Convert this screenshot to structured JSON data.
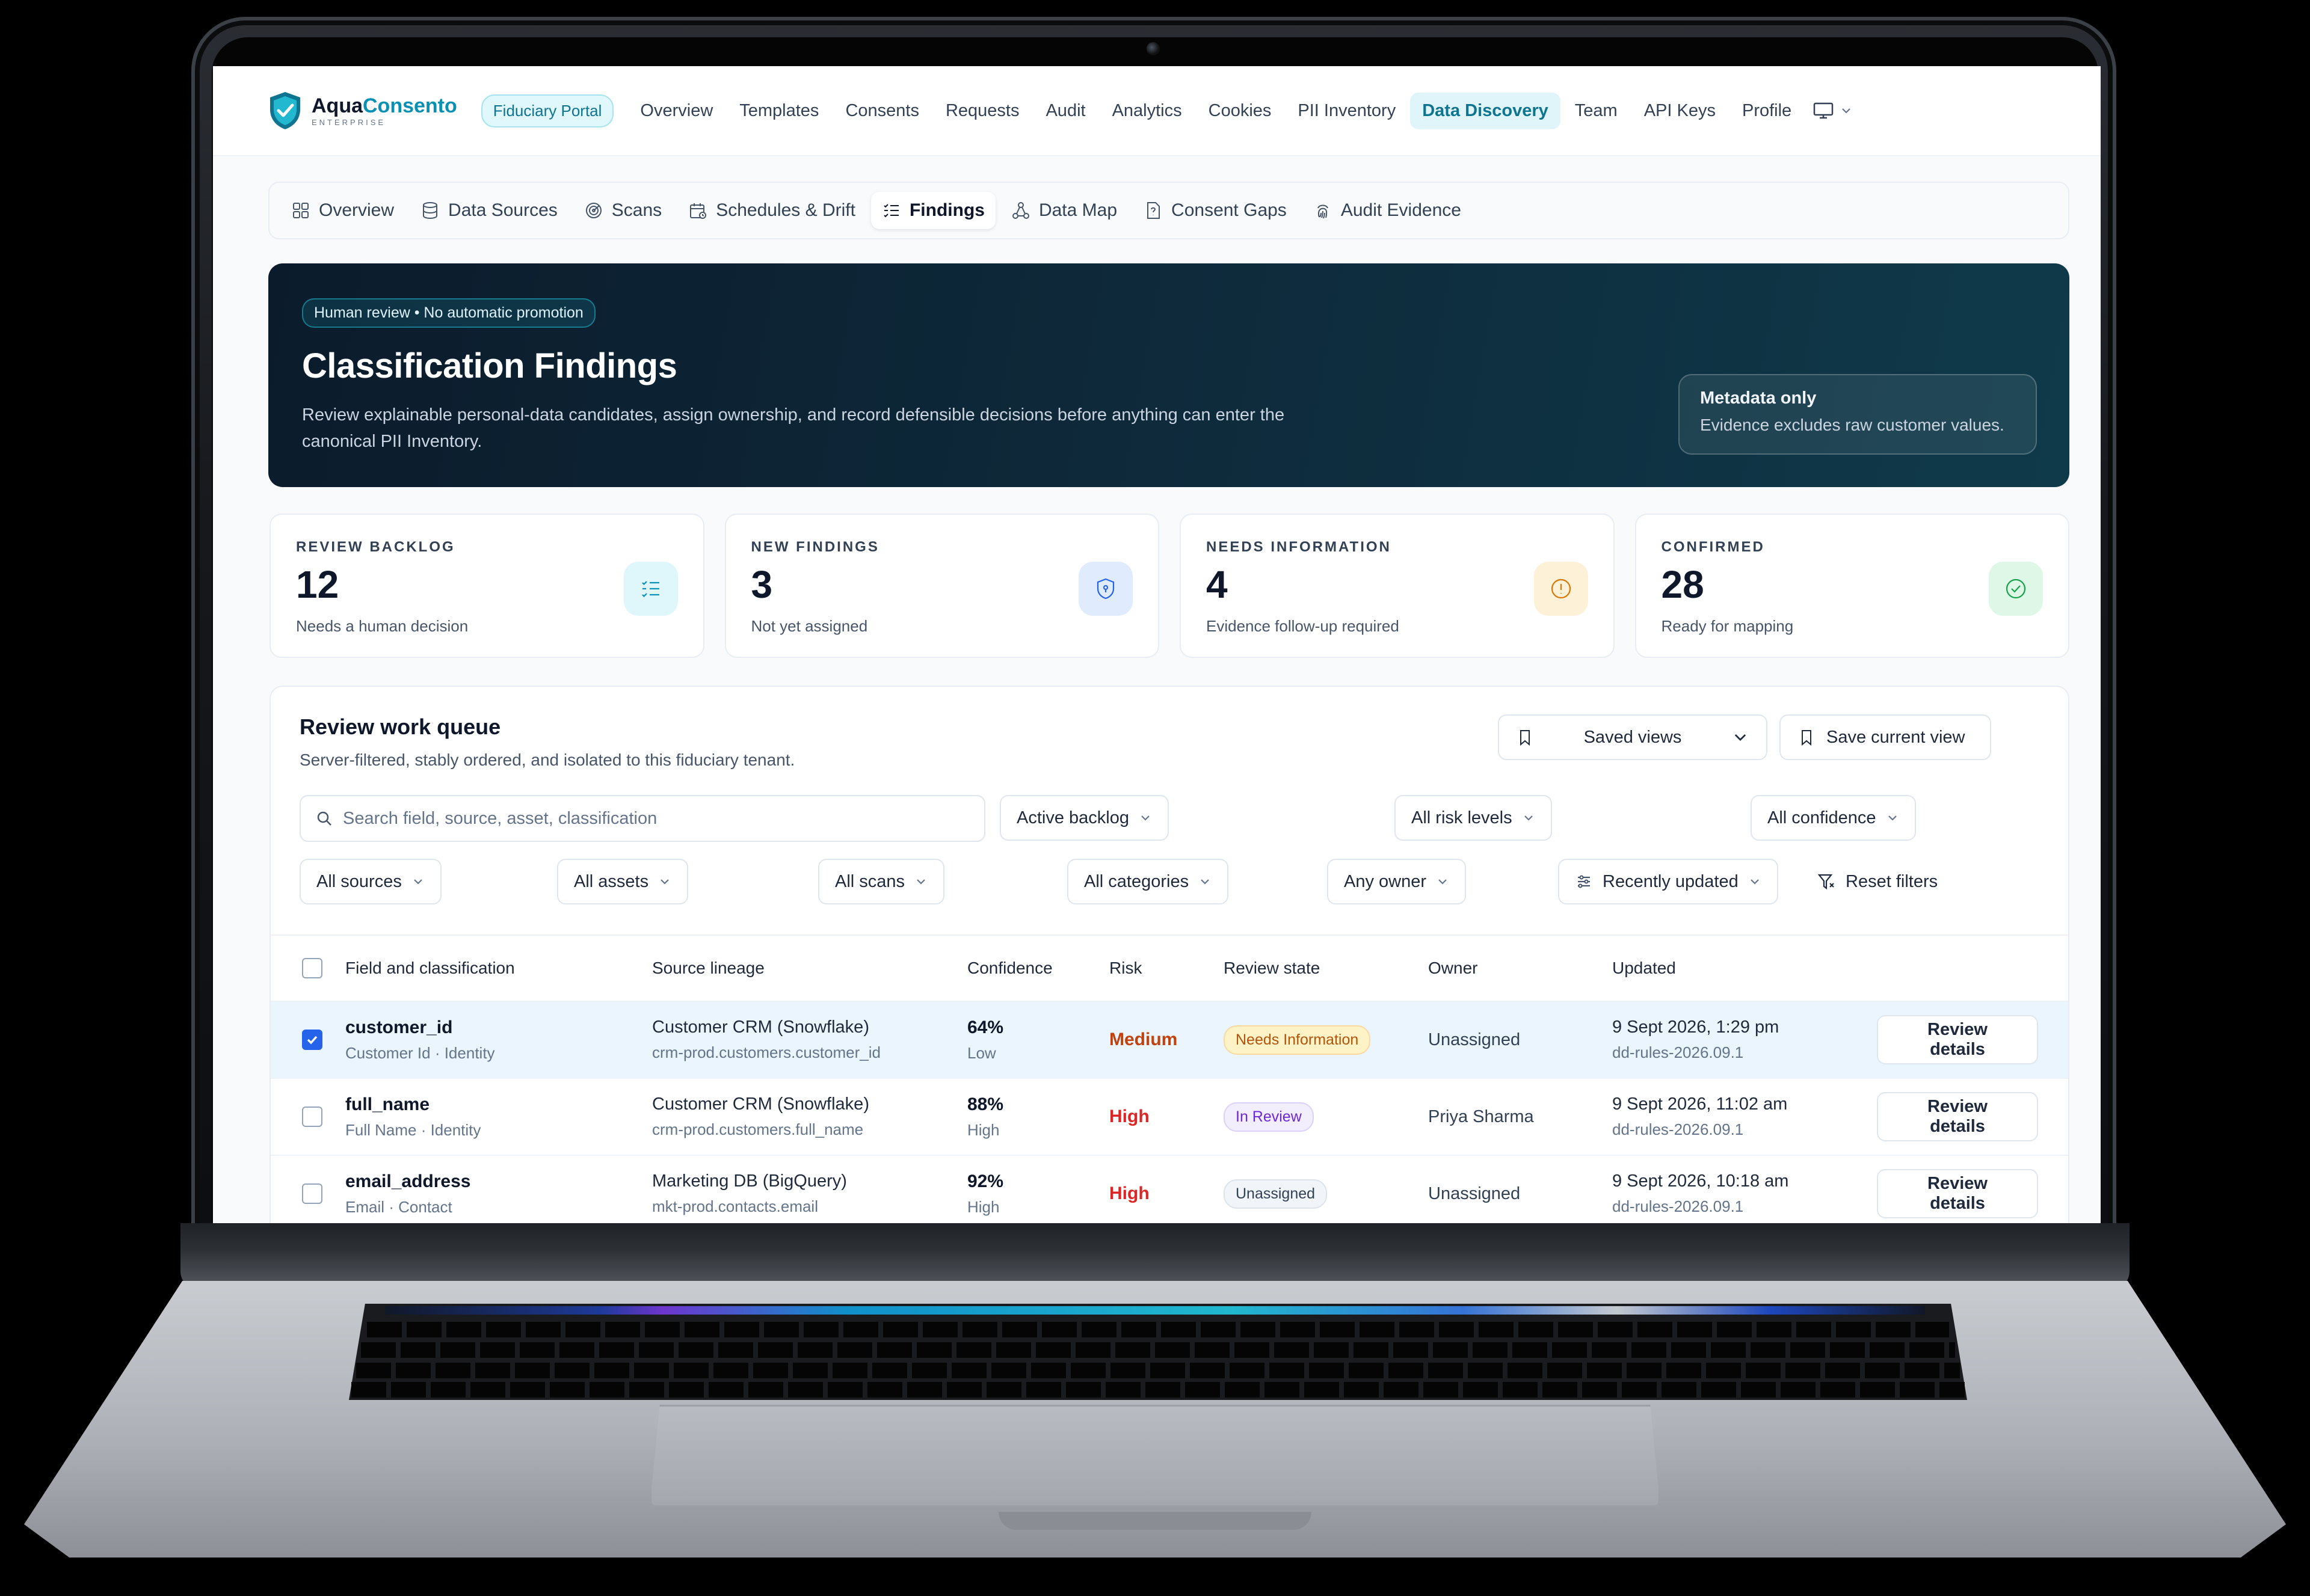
{
  "brand": {
    "name_part1": "Aqua",
    "name_part2": "Consento",
    "tagline": "ENTERPRISE"
  },
  "nav": {
    "portal_pill": "Fiduciary Portal",
    "links": [
      "Overview",
      "Templates",
      "Consents",
      "Requests",
      "Audit",
      "Analytics",
      "Cookies",
      "PII Inventory",
      "Data Discovery",
      "Team",
      "API Keys",
      "Profile"
    ],
    "active": "Data Discovery"
  },
  "subtabs": [
    {
      "label": "Overview",
      "icon": "grid-icon"
    },
    {
      "label": "Data Sources",
      "icon": "database-icon"
    },
    {
      "label": "Scans",
      "icon": "radar-icon"
    },
    {
      "label": "Schedules & Drift",
      "icon": "calendar-icon"
    },
    {
      "label": "Findings",
      "icon": "list-check-icon",
      "active": true
    },
    {
      "label": "Data Map",
      "icon": "network-icon"
    },
    {
      "label": "Consent Gaps",
      "icon": "file-question-icon"
    },
    {
      "label": "Audit Evidence",
      "icon": "fingerprint-icon"
    }
  ],
  "hero": {
    "badge": "Human review • No automatic promotion",
    "title": "Classification Findings",
    "description": "Review explainable personal-data candidates, assign ownership, and record defensible decisions before anything can enter the canonical PII Inventory.",
    "card_title": "Metadata only",
    "card_text": "Evidence excludes raw customer values."
  },
  "stats": [
    {
      "label": "REVIEW BACKLOG",
      "value": "12",
      "sub": "Needs a human decision",
      "icon": "list-check-icon",
      "color": "#0891b2",
      "bg": "#dff6fb"
    },
    {
      "label": "NEW FINDINGS",
      "value": "3",
      "sub": "Not yet assigned",
      "icon": "shield-icon",
      "color": "#2563eb",
      "bg": "#e0ecfd"
    },
    {
      "label": "NEEDS INFORMATION",
      "value": "4",
      "sub": "Evidence follow-up required",
      "icon": "alert-circle-icon",
      "color": "#d97706",
      "bg": "#fdf1d8"
    },
    {
      "label": "CONFIRMED",
      "value": "28",
      "sub": "Ready for mapping",
      "icon": "check-circle-icon",
      "color": "#16a34a",
      "bg": "#def7e7"
    }
  ],
  "queue": {
    "title": "Review work queue",
    "subtitle": "Server-filtered, stably ordered, and isolated to this fiduciary tenant.",
    "saved_views": "Saved views",
    "save_current": "Save current view",
    "search_placeholder": "Search field, source, asset, classification",
    "filters": {
      "status": "Active backlog",
      "risk": "All risk levels",
      "confidence": "All confidence",
      "sources": "All sources",
      "assets": "All assets",
      "scans": "All scans",
      "categories": "All categories",
      "owner": "Any owner",
      "sort": "Recently updated",
      "reset": "Reset filters"
    },
    "columns": [
      "Field and classification",
      "Source lineage",
      "Confidence",
      "Risk",
      "Review state",
      "Owner",
      "Updated"
    ],
    "rows": [
      {
        "checked": true,
        "field": "customer_id",
        "classification": "Customer Id · Identity",
        "source": "Customer CRM (Snowflake)",
        "path": "crm-prod.customers.customer_id",
        "confidence": "64%",
        "confidence_level": "Low",
        "risk": "Medium",
        "risk_color": "#c2410c",
        "state": "Needs Information",
        "state_fg": "#b45309",
        "state_bg": "#fef3c7",
        "state_border": "#fcd9a0",
        "owner": "Unassigned",
        "updated": "9 Sept 2026, 1:29 pm",
        "ruleset": "dd-rules-2026.09.1",
        "action": "Review details"
      },
      {
        "checked": false,
        "field": "full_name",
        "classification": "Full Name · Identity",
        "source": "Customer CRM (Snowflake)",
        "path": "crm-prod.customers.full_name",
        "confidence": "88%",
        "confidence_level": "High",
        "risk": "High",
        "risk_color": "#dc2626",
        "state": "In Review",
        "state_fg": "#6d28d9",
        "state_bg": "#f3eefe",
        "state_border": "#ddd0fb",
        "owner": "Priya Sharma",
        "updated": "9 Sept 2026, 11:02 am",
        "ruleset": "dd-rules-2026.09.1",
        "action": "Review details"
      },
      {
        "checked": false,
        "field": "email_address",
        "classification": "Email · Contact",
        "source": "Marketing DB (BigQuery)",
        "path": "mkt-prod.contacts.email",
        "confidence": "92%",
        "confidence_level": "High",
        "risk": "High",
        "risk_color": "#dc2626",
        "state": "Unassigned",
        "state_fg": "#334155",
        "state_bg": "#f1f5f9",
        "state_border": "#dde3ea",
        "owner": "Unassigned",
        "updated": "9 Sept 2026, 10:18 am",
        "ruleset": "dd-rules-2026.09.1",
        "action": "Review details"
      }
    ]
  }
}
